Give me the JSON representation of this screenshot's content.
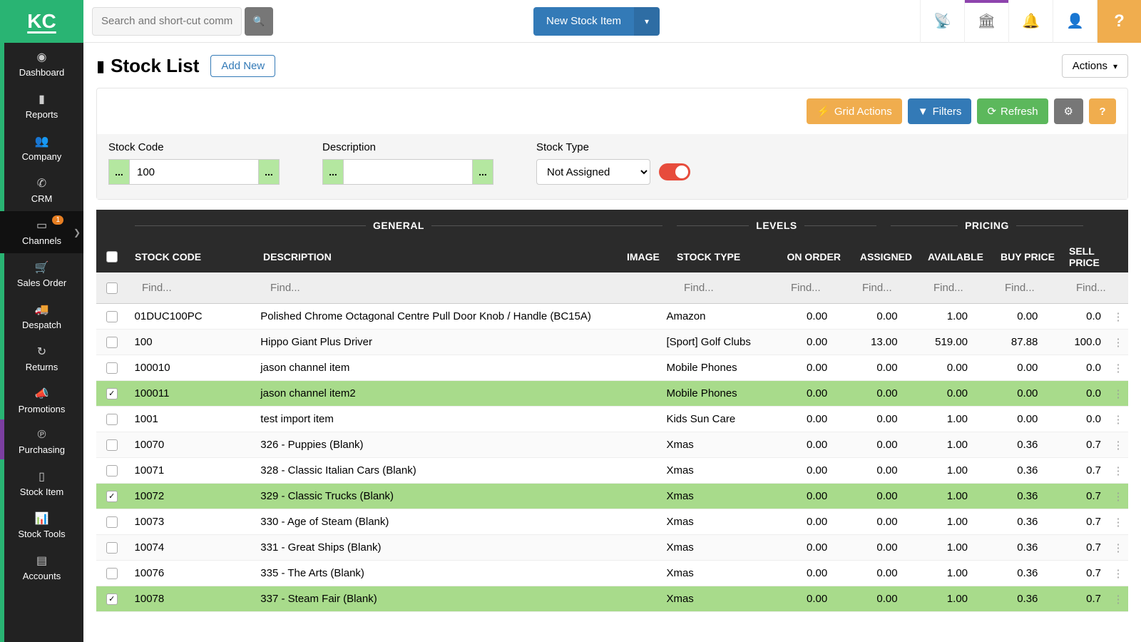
{
  "logo": "KC",
  "search": {
    "placeholder": "Search and short-cut commar"
  },
  "top": {
    "new_stock": "New Stock Item",
    "help": "?"
  },
  "sidebar": {
    "items": [
      {
        "label": "Dashboard",
        "icon": "◉"
      },
      {
        "label": "Reports",
        "icon": "▮"
      },
      {
        "label": "Company",
        "icon": "👥"
      },
      {
        "label": "CRM",
        "icon": "✆"
      },
      {
        "label": "Channels",
        "icon": "▭",
        "badge": "1"
      },
      {
        "label": "Sales Order",
        "icon": "🛒"
      },
      {
        "label": "Despatch",
        "icon": "🚚"
      },
      {
        "label": "Returns",
        "icon": "↻"
      },
      {
        "label": "Promotions",
        "icon": "📣"
      },
      {
        "label": "Purchasing",
        "icon": "℗"
      },
      {
        "label": "Stock Item",
        "icon": "▯"
      },
      {
        "label": "Stock Tools",
        "icon": "📊"
      },
      {
        "label": "Accounts",
        "icon": "▤"
      }
    ]
  },
  "page": {
    "title": "Stock List",
    "add_new": "Add New",
    "actions": "Actions"
  },
  "toolbar": {
    "grid_actions": "Grid Actions",
    "filters": "Filters",
    "refresh": "Refresh",
    "help": "?"
  },
  "filters": {
    "stock_code_label": "Stock Code",
    "stock_code_value": "100",
    "description_label": "Description",
    "description_value": "",
    "stock_type_label": "Stock Type",
    "stock_type_value": "Not Assigned",
    "dots": "..."
  },
  "table": {
    "groups": {
      "general": "GENERAL",
      "levels": "LEVELS",
      "pricing": "PRICING"
    },
    "cols": {
      "code": "STOCK CODE",
      "desc": "DESCRIPTION",
      "img": "IMAGE",
      "type": "STOCK TYPE",
      "ord": "ON ORDER",
      "ass": "ASSIGNED",
      "ava": "AVAILABLE",
      "buy": "BUY PRICE",
      "sell": "SELL PRICE"
    },
    "find": "Find...",
    "rows": [
      {
        "sel": false,
        "code": "01DUC100PC",
        "desc": "Polished Chrome Octagonal Centre Pull Door Knob / Handle (BC15A)",
        "type": "Amazon",
        "ord": "0.00",
        "ass": "0.00",
        "ava": "1.00",
        "buy": "0.00",
        "sell": "0.0"
      },
      {
        "sel": false,
        "code": "100",
        "desc": "Hippo Giant Plus Driver",
        "type": "[Sport] Golf Clubs",
        "ord": "0.00",
        "ass": "13.00",
        "ava": "519.00",
        "buy": "87.88",
        "sell": "100.0"
      },
      {
        "sel": false,
        "code": "100010",
        "desc": "jason channel item",
        "type": "Mobile Phones",
        "ord": "0.00",
        "ass": "0.00",
        "ava": "0.00",
        "buy": "0.00",
        "sell": "0.0"
      },
      {
        "sel": true,
        "code": "100011",
        "desc": "jason channel item2",
        "type": "Mobile Phones",
        "ord": "0.00",
        "ass": "0.00",
        "ava": "0.00",
        "buy": "0.00",
        "sell": "0.0"
      },
      {
        "sel": false,
        "code": "1001",
        "desc": "test import item",
        "type": "Kids Sun Care",
        "ord": "0.00",
        "ass": "0.00",
        "ava": "1.00",
        "buy": "0.00",
        "sell": "0.0"
      },
      {
        "sel": false,
        "code": "10070",
        "desc": "326 - Puppies (Blank)",
        "type": "Xmas",
        "ord": "0.00",
        "ass": "0.00",
        "ava": "1.00",
        "buy": "0.36",
        "sell": "0.7"
      },
      {
        "sel": false,
        "code": "10071",
        "desc": "328 - Classic Italian Cars (Blank)",
        "type": "Xmas",
        "ord": "0.00",
        "ass": "0.00",
        "ava": "1.00",
        "buy": "0.36",
        "sell": "0.7"
      },
      {
        "sel": true,
        "code": "10072",
        "desc": "329 - Classic Trucks (Blank)",
        "type": "Xmas",
        "ord": "0.00",
        "ass": "0.00",
        "ava": "1.00",
        "buy": "0.36",
        "sell": "0.7"
      },
      {
        "sel": false,
        "code": "10073",
        "desc": "330 - Age of Steam (Blank)",
        "type": "Xmas",
        "ord": "0.00",
        "ass": "0.00",
        "ava": "1.00",
        "buy": "0.36",
        "sell": "0.7"
      },
      {
        "sel": false,
        "code": "10074",
        "desc": "331 - Great Ships (Blank)",
        "type": "Xmas",
        "ord": "0.00",
        "ass": "0.00",
        "ava": "1.00",
        "buy": "0.36",
        "sell": "0.7"
      },
      {
        "sel": false,
        "code": "10076",
        "desc": "335 - The Arts (Blank)",
        "type": "Xmas",
        "ord": "0.00",
        "ass": "0.00",
        "ava": "1.00",
        "buy": "0.36",
        "sell": "0.7"
      },
      {
        "sel": true,
        "code": "10078",
        "desc": "337 - Steam Fair (Blank)",
        "type": "Xmas",
        "ord": "0.00",
        "ass": "0.00",
        "ava": "1.00",
        "buy": "0.36",
        "sell": "0.7"
      }
    ]
  }
}
